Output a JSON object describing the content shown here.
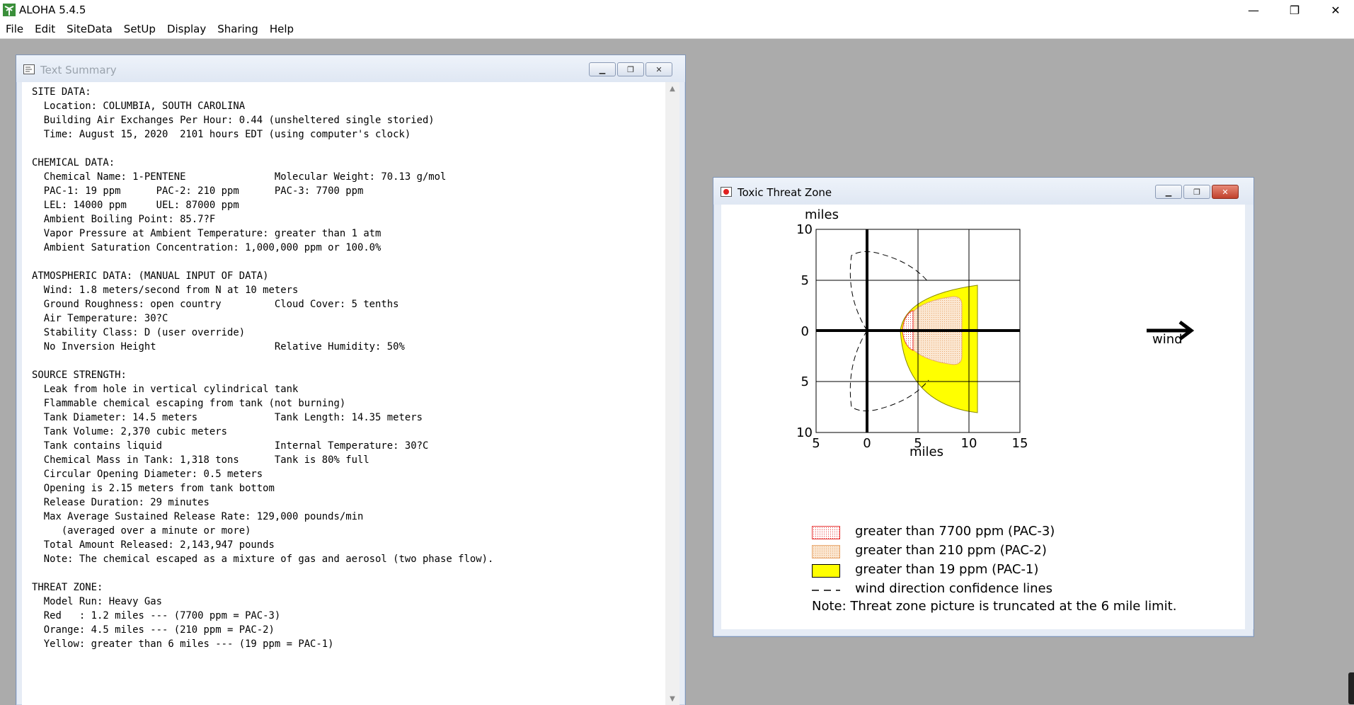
{
  "app": {
    "title": "ALOHA 5.4.5",
    "window_controls": {
      "minimize": "—",
      "maximize": "❐",
      "close": "✕"
    }
  },
  "menu": [
    "File",
    "Edit",
    "SiteData",
    "SetUp",
    "Display",
    "Sharing",
    "Help"
  ],
  "text_summary": {
    "title": "Text Summary",
    "body": "SITE DATA:\n  Location: COLUMBIA, SOUTH CAROLINA\n  Building Air Exchanges Per Hour: 0.44 (unsheltered single storied)\n  Time: August 15, 2020  2101 hours EDT (using computer's clock)\n\nCHEMICAL DATA:\n  Chemical Name: 1-PENTENE               Molecular Weight: 70.13 g/mol\n  PAC-1: 19 ppm      PAC-2: 210 ppm      PAC-3: 7700 ppm\n  LEL: 14000 ppm     UEL: 87000 ppm\n  Ambient Boiling Point: 85.7?F\n  Vapor Pressure at Ambient Temperature: greater than 1 atm\n  Ambient Saturation Concentration: 1,000,000 ppm or 100.0%\n\nATMOSPHERIC DATA: (MANUAL INPUT OF DATA)\n  Wind: 1.8 meters/second from N at 10 meters\n  Ground Roughness: open country         Cloud Cover: 5 tenths\n  Air Temperature: 30?C\n  Stability Class: D (user override)\n  No Inversion Height                    Relative Humidity: 50%\n\nSOURCE STRENGTH:\n  Leak from hole in vertical cylindrical tank\n  Flammable chemical escaping from tank (not burning)\n  Tank Diameter: 14.5 meters             Tank Length: 14.35 meters\n  Tank Volume: 2,370 cubic meters\n  Tank contains liquid                   Internal Temperature: 30?C\n  Chemical Mass in Tank: 1,318 tons      Tank is 80% full\n  Circular Opening Diameter: 0.5 meters\n  Opening is 2.15 meters from tank bottom\n  Release Duration: 29 minutes\n  Max Average Sustained Release Rate: 129,000 pounds/min\n     (averaged over a minute or more)\n  Total Amount Released: 2,143,947 pounds\n  Note: The chemical escaped as a mixture of gas and aerosol (two phase flow).\n\nTHREAT ZONE:\n  Model Run: Heavy Gas\n  Red   : 1.2 miles --- (7700 ppm = PAC-3)\n  Orange: 4.5 miles --- (210 ppm = PAC-2)\n  Yellow: greater than 6 miles --- (19 ppm = PAC-1)"
  },
  "threat_zone": {
    "title": "Toxic Threat Zone",
    "y_axis_label": "miles",
    "x_axis_label": "miles",
    "y_ticks": [
      "10",
      "5",
      "0",
      "5",
      "10"
    ],
    "x_ticks": [
      "5",
      "0",
      "5",
      "10",
      "15"
    ],
    "x_range_miles": [
      -5,
      15
    ],
    "y_range_miles": [
      -10,
      10
    ],
    "wind_label": "wind",
    "zones": [
      {
        "name": "red",
        "distance_miles": 1.2,
        "color": "#e83a3a"
      },
      {
        "name": "orange",
        "distance_miles": 4.5,
        "color": "#f7d7b5"
      },
      {
        "name": "yellow",
        "distance_miles": 6,
        "color": "#ffff00"
      }
    ],
    "legend": [
      {
        "label": "greater than 7700 ppm (PAC-3)",
        "swatch": "red-dotted"
      },
      {
        "label": "greater than 210 ppm (PAC-2)",
        "swatch": "orange-dotted"
      },
      {
        "label": "greater than 19 ppm (PAC-1)",
        "swatch": "yellow"
      },
      {
        "label": "wind direction confidence lines",
        "swatch": "dashed-line"
      }
    ],
    "note": "Note: Threat zone picture is truncated at the 6 mile limit."
  }
}
